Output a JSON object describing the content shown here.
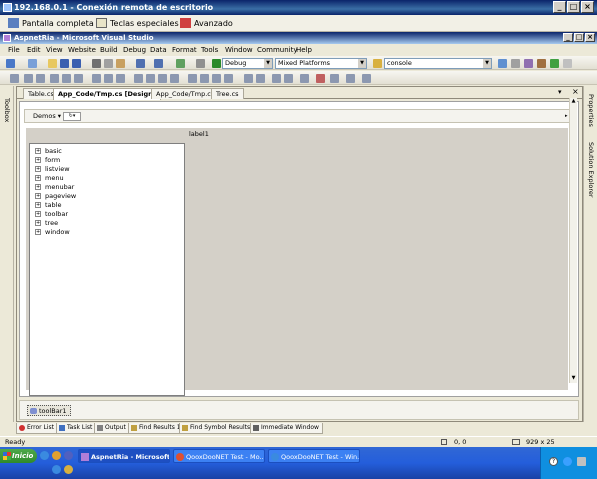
{
  "remote": {
    "title": "192.168.0.1 - Conexión remota de escritorio",
    "fullscreen": "Pantalla completa",
    "keys": "Teclas especiales",
    "advanced": "Avanzado"
  },
  "vs": {
    "title": "AspnetRia - Microsoft Visual Studio"
  },
  "menu": [
    "File",
    "Edit",
    "View",
    "Website",
    "Build",
    "Debug",
    "Data",
    "Format",
    "Tools",
    "Window",
    "Community",
    "Help"
  ],
  "toolbar": {
    "config": "Debug",
    "platform": "Mixed Platforms",
    "find": "console"
  },
  "side": {
    "toolbox": "Toolbox",
    "properties": "Properties",
    "solution": "Solution Explorer"
  },
  "tabs": [
    {
      "label": "Table.cs",
      "active": false
    },
    {
      "label": "App_Code/Tmp.cs [Design]",
      "active": true
    },
    {
      "label": "App_Code/Tmp.cs",
      "active": false
    },
    {
      "label": "Tree.cs",
      "active": false
    }
  ],
  "designer": {
    "demos": "Demos",
    "label": "label1",
    "tray": "toolBar1"
  },
  "tree": [
    "basic",
    "form",
    "listview",
    "menu",
    "menubar",
    "pageview",
    "table",
    "toolbar",
    "tree",
    "window"
  ],
  "bottom_tabs": [
    "Error List",
    "Task List",
    "Output",
    "Find Results 1",
    "Find Symbol Results",
    "Immediate Window"
  ],
  "status": {
    "text": "Ready",
    "pos": "0, 0",
    "size": "929 x 25"
  },
  "taskbar": {
    "start": "Inicio",
    "items": [
      "AspnetRia - Microsoft...",
      "QooxDooNET Test - Mo...",
      "QooxDooNET Test - Win..."
    ]
  },
  "colors": {
    "xp_blue": "#245edb",
    "vs_title": "#0a246a"
  }
}
